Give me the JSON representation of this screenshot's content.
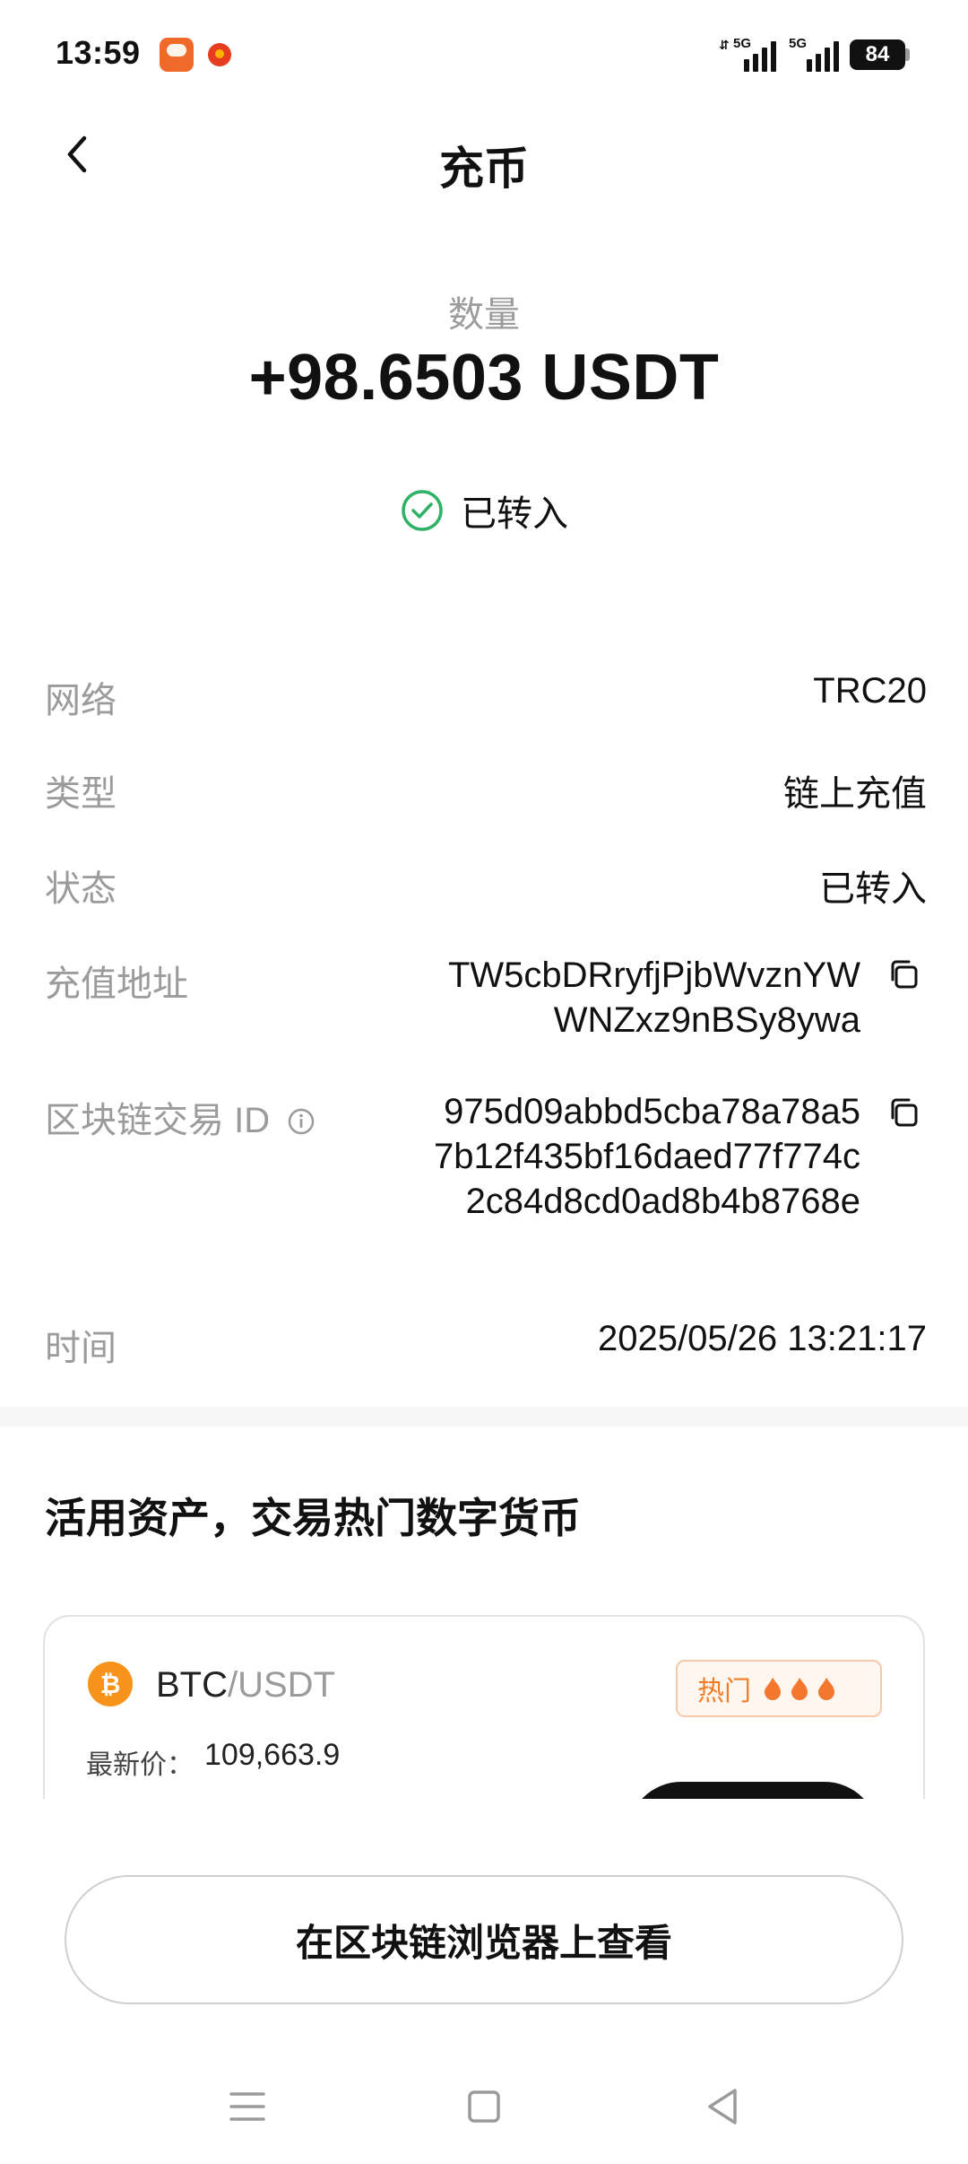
{
  "status_bar": {
    "time": "13:59",
    "signal_1_label": "5G",
    "signal_2_label": "5G",
    "battery": "84"
  },
  "header": {
    "title": "充币",
    "back_icon": "chevron-left-icon"
  },
  "summary": {
    "amount_label": "数量",
    "amount": "+98.6503 USDT",
    "status": "已转入",
    "status_icon": "check-circle-icon",
    "status_color": "#2fb166"
  },
  "details": {
    "network_label": "网络",
    "network": "TRC20",
    "type_label": "类型",
    "type": "链上充值",
    "state_label": "状态",
    "state": "已转入",
    "address_label": "充值地址",
    "address": "TW5cbDRryfjPjbWvznYWWNZxz9nBSy8ywa",
    "txid_label": "区块链交易 ID",
    "txid": "975d09abbd5cba78a78a57b12f435bf16daed77f774c2c84d8cd0ad8b4b8768e",
    "time_label": "时间",
    "time": "2025/05/26 13:21:17"
  },
  "promo": {
    "title": "活用资产，交易热门数字货币",
    "card": {
      "base": "BTC",
      "quote": "/USDT",
      "hot_label": "热门",
      "price_label": "最新价：",
      "price": "109,663.9",
      "accent": "#f7931a"
    }
  },
  "footer": {
    "explorer_button": "在区块链浏览器上查看"
  },
  "nav": {
    "menu_icon": "menu-icon",
    "home_icon": "square-icon",
    "back_icon": "triangle-back-icon"
  }
}
